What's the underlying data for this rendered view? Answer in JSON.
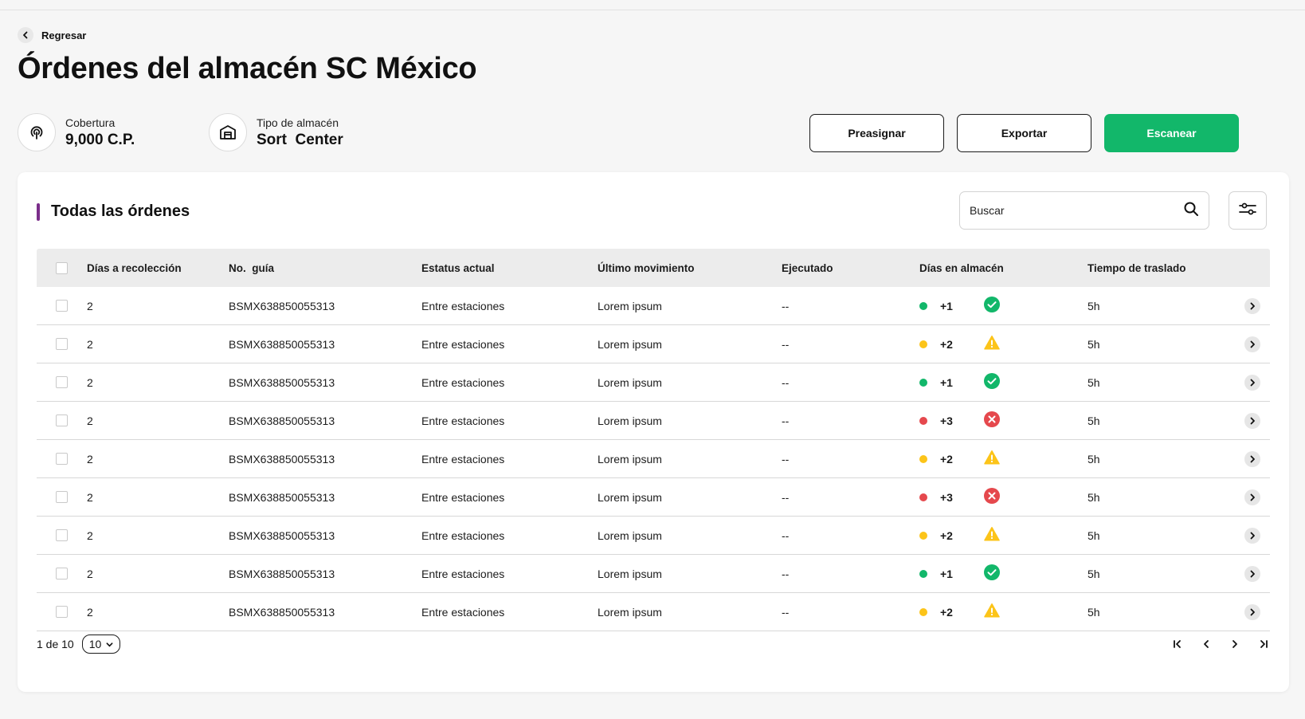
{
  "header": {
    "back_label": "Regresar",
    "title": "Órdenes del almacén SC México",
    "coverage_label": "Cobertura",
    "coverage_value": "9,000 C.P.",
    "type_label": "Tipo de almacén",
    "type_value": "Sort  Center"
  },
  "actions": {
    "preassign": "Preasignar",
    "export": "Exportar",
    "scan": "Escanear"
  },
  "card": {
    "title": "Todas las órdenes",
    "search_placeholder": "Buscar"
  },
  "table": {
    "columns": [
      "Días a recolección",
      "No.  guía",
      "Estatus actual",
      "Último movimiento",
      "Ejecutado",
      "Días en almacén",
      "Tiempo de traslado"
    ],
    "rows": [
      {
        "days": "2",
        "guide": "BSMX638850055313",
        "status": "Entre estaciones",
        "last": "Lorem ipsum",
        "executed": "--",
        "store": "+1",
        "level": "ok",
        "time": "5h"
      },
      {
        "days": "2",
        "guide": "BSMX638850055313",
        "status": "Entre estaciones",
        "last": "Lorem ipsum",
        "executed": "--",
        "store": "+2",
        "level": "warn",
        "time": "5h"
      },
      {
        "days": "2",
        "guide": "BSMX638850055313",
        "status": "Entre estaciones",
        "last": "Lorem ipsum",
        "executed": "--",
        "store": "+1",
        "level": "ok",
        "time": "5h"
      },
      {
        "days": "2",
        "guide": "BSMX638850055313",
        "status": "Entre estaciones",
        "last": "Lorem ipsum",
        "executed": "--",
        "store": "+3",
        "level": "error",
        "time": "5h"
      },
      {
        "days": "2",
        "guide": "BSMX638850055313",
        "status": "Entre estaciones",
        "last": "Lorem ipsum",
        "executed": "--",
        "store": "+2",
        "level": "warn",
        "time": "5h"
      },
      {
        "days": "2",
        "guide": "BSMX638850055313",
        "status": "Entre estaciones",
        "last": "Lorem ipsum",
        "executed": "--",
        "store": "+3",
        "level": "error",
        "time": "5h"
      },
      {
        "days": "2",
        "guide": "BSMX638850055313",
        "status": "Entre estaciones",
        "last": "Lorem ipsum",
        "executed": "--",
        "store": "+2",
        "level": "warn",
        "time": "5h"
      },
      {
        "days": "2",
        "guide": "BSMX638850055313",
        "status": "Entre estaciones",
        "last": "Lorem ipsum",
        "executed": "--",
        "store": "+1",
        "level": "ok",
        "time": "5h"
      },
      {
        "days": "2",
        "guide": "BSMX638850055313",
        "status": "Entre estaciones",
        "last": "Lorem ipsum",
        "executed": "--",
        "store": "+2",
        "level": "warn",
        "time": "5h"
      }
    ]
  },
  "pagination": {
    "page_text": "1 de 10",
    "page_size": "10"
  },
  "colors": {
    "ok": "#12b76a",
    "warn": "#fcc419",
    "error": "#e5484d",
    "accent": "#7b2e8a"
  }
}
